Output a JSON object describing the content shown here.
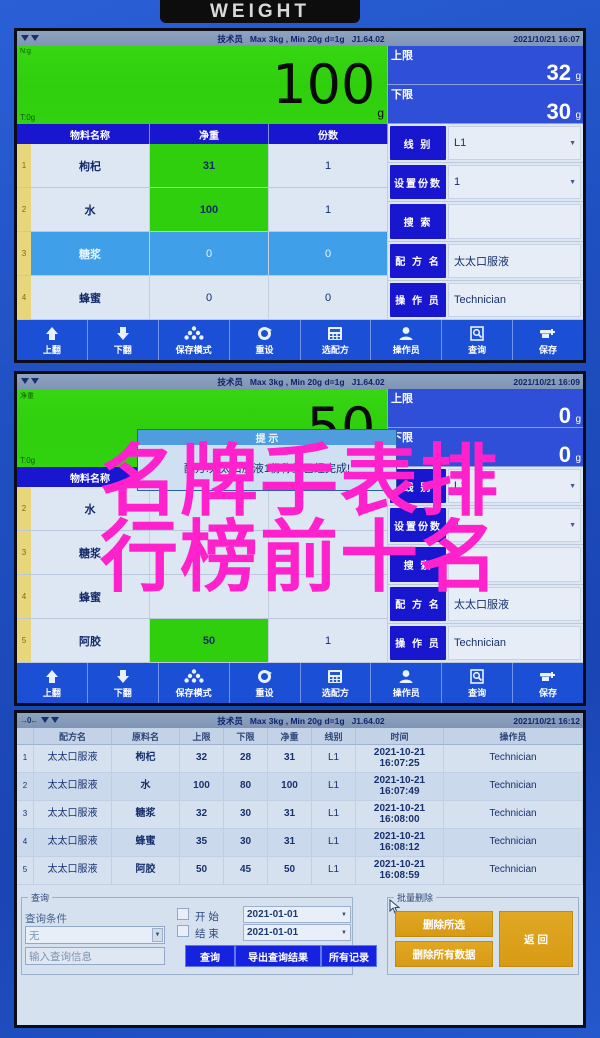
{
  "device": {
    "badge_label": "WEIGHT",
    "bezel_color": "#1f50c2"
  },
  "common": {
    "status": {
      "operator": "技术员",
      "capacity": "Max 3kg , Min 20g  d=1g",
      "version": "J1.64.02",
      "zero_icon": "zero-indicator-icon",
      "stable_icon": "stability-icon"
    },
    "toolbar": [
      {
        "label": "上翻",
        "icon": "arrow-up-icon"
      },
      {
        "label": "下翻",
        "icon": "arrow-down-icon"
      },
      {
        "label": "保存模式",
        "icon": "stack-icon"
      },
      {
        "label": "重设",
        "icon": "refresh-icon"
      },
      {
        "label": "选配方",
        "icon": "calculator-icon"
      },
      {
        "label": "操作员",
        "icon": "user-icon"
      },
      {
        "label": "查询",
        "icon": "search-doc-icon"
      },
      {
        "label": "保存",
        "icon": "save-plus-icon"
      }
    ]
  },
  "panel1": {
    "status": {
      "datetime": "2021/10/21  16:07"
    },
    "display": {
      "value": "100",
      "unit": "g",
      "tare_label": "T:0g",
      "net_label": "N:g"
    },
    "limits": [
      {
        "label": "上限",
        "value": "32",
        "unit": "g"
      },
      {
        "label": "下限",
        "value": "30",
        "unit": "g"
      }
    ],
    "fields": [
      {
        "label": "线  别",
        "value": "L1",
        "caret": true
      },
      {
        "label": "设置份数",
        "value": "1",
        "caret": true
      },
      {
        "label": "搜  索",
        "value": "",
        "caret": false
      },
      {
        "label": "配 方 名",
        "value": "太太口服液",
        "caret": false
      },
      {
        "label": "操 作 员",
        "value": "Technician",
        "caret": false
      }
    ],
    "table": {
      "headers": [
        "物料名称",
        "净重",
        "份数"
      ],
      "rows": [
        {
          "idx": "1",
          "name": "枸杞",
          "net": "31",
          "qty": "1",
          "net_green": true,
          "selected": false
        },
        {
          "idx": "2",
          "name": "水",
          "net": "100",
          "qty": "1",
          "net_green": true,
          "selected": false
        },
        {
          "idx": "3",
          "name": "糖浆",
          "net": "0",
          "qty": "0",
          "net_green": false,
          "selected": true
        },
        {
          "idx": "4",
          "name": "蜂蜜",
          "net": "0",
          "qty": "0",
          "net_green": false,
          "selected": false
        }
      ]
    }
  },
  "panel2": {
    "status": {
      "datetime": "2021/10/21  16:09"
    },
    "display": {
      "value": "50",
      "unit": "g",
      "tare_label": "T:0g",
      "net_label": "净重"
    },
    "limits": [
      {
        "label": "上限",
        "value": "0",
        "unit": "g"
      },
      {
        "label": "下限",
        "value": "0",
        "unit": "g"
      }
    ],
    "fields": [
      {
        "label": "线  别",
        "value": "L1",
        "caret": true
      },
      {
        "label": "设置份数",
        "value": "1",
        "caret": true
      },
      {
        "label": "搜  索",
        "value": "",
        "caret": false
      },
      {
        "label": "配 方 名",
        "value": "太太口服液",
        "caret": false
      },
      {
        "label": "操 作 员",
        "value": "Technician",
        "caret": false
      }
    ],
    "table": {
      "headers": [
        "物料名称",
        "净重",
        "份数"
      ],
      "rows": [
        {
          "idx": "2",
          "name": "水",
          "net": "",
          "qty": "",
          "net_green": false,
          "selected": false
        },
        {
          "idx": "3",
          "name": "糖浆",
          "net": "",
          "qty": "",
          "net_green": false,
          "selected": false
        },
        {
          "idx": "4",
          "name": "蜂蜜",
          "net": "",
          "qty": "",
          "net_green": false,
          "selected": false
        },
        {
          "idx": "5",
          "name": "阿胶",
          "net": "50",
          "qty": "1",
          "net_green": true,
          "selected": false
        }
      ]
    },
    "dialog": {
      "title": "提 示",
      "message": "配方:太太口服液1份称重已经完成!"
    }
  },
  "panel3": {
    "status": {
      "datetime": "2021/10/21  16:12"
    },
    "table": {
      "headers": [
        "配方名",
        "原料名",
        "上限",
        "下限",
        "净重",
        "线别",
        "时间",
        "操作员"
      ],
      "rows": [
        {
          "idx": "1",
          "recipe": "太太口服液",
          "material": "枸杞",
          "upper": "32",
          "lower": "28",
          "net": "31",
          "line": "L1",
          "time": "2021-10-21\n16:07:25",
          "operator": "Technician"
        },
        {
          "idx": "2",
          "recipe": "太太口服液",
          "material": "水",
          "upper": "100",
          "lower": "80",
          "net": "100",
          "line": "L1",
          "time": "2021-10-21\n16:07:49",
          "operator": "Technician"
        },
        {
          "idx": "3",
          "recipe": "太太口服液",
          "material": "糖浆",
          "upper": "32",
          "lower": "30",
          "net": "31",
          "line": "L1",
          "time": "2021-10-21\n16:08:00",
          "operator": "Technician"
        },
        {
          "idx": "4",
          "recipe": "太太口服液",
          "material": "蜂蜜",
          "upper": "35",
          "lower": "30",
          "net": "31",
          "line": "L1",
          "time": "2021-10-21\n16:08:12",
          "operator": "Technician"
        },
        {
          "idx": "5",
          "recipe": "太太口服液",
          "material": "阿胶",
          "upper": "50",
          "lower": "45",
          "net": "50",
          "line": "L1",
          "time": "2021-10-21\n16:08:59",
          "operator": "Technician"
        }
      ]
    },
    "query": {
      "group_label": "查询",
      "condition_label": "查询条件",
      "condition_value": "无",
      "info_placeholder": "输入查询信息",
      "start_label": "开  始",
      "end_label": "结  束",
      "start_date": "2021-01-01",
      "end_date": "2021-01-01",
      "buttons": [
        "查询",
        "导出查询结果",
        "所有记录"
      ]
    },
    "batch": {
      "group_label": "批量删除",
      "delete_selected": "删除所选",
      "delete_all": "删除所有数据",
      "back": "返    回"
    }
  },
  "overlay": {
    "line1": "名牌手表排",
    "line2": "行榜前十名",
    "color": "#ff22cc"
  }
}
